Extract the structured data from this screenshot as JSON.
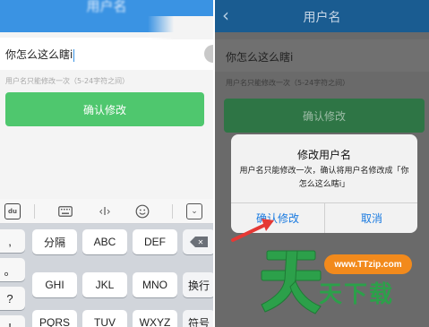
{
  "left": {
    "header_title": "用户名",
    "input_value": "你怎么这么瞎i",
    "hint": "用户名只能修改一次（5-24字符之间）",
    "confirm_label": "确认修改",
    "keyboard": {
      "logo": "du",
      "cursor_glyph": "‹I›",
      "hide_glyph": "⌄",
      "left_column": [
        ",",
        "。",
        "?",
        "!"
      ],
      "row1": [
        "分隔",
        "ABC",
        "DEF"
      ],
      "row2": [
        "GHI",
        "JKL",
        "MNO"
      ],
      "row3": [
        "PQRS",
        "TUV",
        "WXYZ"
      ],
      "delete_glyph": "✕",
      "enter_label": "换行",
      "symbol_label": "符号"
    }
  },
  "right": {
    "header_title": "用户名",
    "back_glyph": "‹",
    "input_value": "你怎么这么瞎i",
    "hint": "用户名只能修改一次（5-24字符之间）",
    "confirm_label": "确认修改",
    "dialog": {
      "title": "修改用户名",
      "message": "用户名只能修改一次，确认将用户名修改成「你怎么这么瞎i」",
      "ok_label": "确认修改",
      "cancel_label": "取消"
    }
  },
  "watermark": {
    "url": "www.TTzip.com",
    "text": "天下载"
  },
  "colors": {
    "header_blue": "#3a93e3",
    "confirm_green": "#4fc76e",
    "dialog_button_blue": "#1b7be0",
    "arrow_red": "#e53935",
    "watermark_green": "#2ca04a",
    "watermark_orange": "#f28a1c"
  }
}
